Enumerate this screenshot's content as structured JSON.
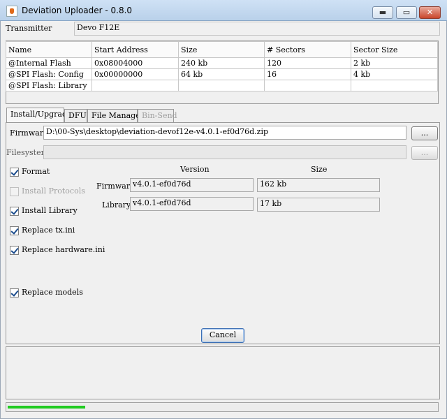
{
  "window": {
    "title": "Deviation Uploader - 0.8.0",
    "min_glyph": "▬",
    "max_glyph": "▭",
    "close_glyph": "✕"
  },
  "transmitter": {
    "label": "Transmitter",
    "value": "Devo F12E"
  },
  "memory_table": {
    "columns": [
      "Name",
      "Start Address",
      "Size",
      "# Sectors",
      "Sector Size"
    ],
    "rows": [
      [
        "@Internal Flash",
        "0x08004000",
        "240 kb",
        "120",
        "2 kb"
      ],
      [
        "@SPI Flash: Config",
        "0x00000000",
        "64 kb",
        "16",
        "4 kb"
      ],
      [
        "@SPI Flash: Library",
        "",
        "",
        "",
        ""
      ]
    ]
  },
  "tabs": [
    {
      "label": "Install/Upgrade"
    },
    {
      "label": "DFU"
    },
    {
      "label": "File Manager"
    },
    {
      "label": "Bin-Send"
    }
  ],
  "install": {
    "firmware_label": "Firmware",
    "firmware_path": "D:\\00-Sys\\desktop\\deviation-devof12e-v4.0.1-ef0d76d.zip",
    "filesystem_label": "Filesystem",
    "filesystem_path": "",
    "browse_label": "...",
    "version_header": "Version",
    "size_header": "Size",
    "firmware_row_label": "Firmware",
    "firmware_version": "v4.0.1-ef0d76d",
    "firmware_size": "162 kb",
    "library_row_label": "Library",
    "library_version": "v4.0.1-ef0d76d",
    "library_size": "17 kb",
    "options": {
      "format": "Format",
      "install_protocols": "Install Protocols",
      "install_library": "Install Library",
      "replace_tx_ini": "Replace tx.ini",
      "replace_hardware_ini": "Replace hardware.ini",
      "replace_models": "Replace models"
    },
    "cancel_label": "Cancel"
  },
  "progress": {
    "fraction": 0.18,
    "color": "#22cc22"
  }
}
